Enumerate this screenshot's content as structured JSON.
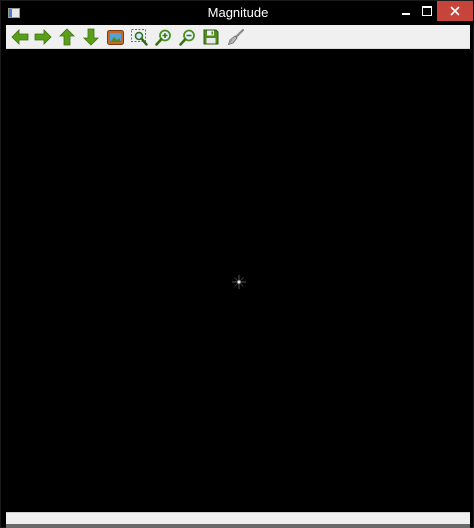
{
  "window": {
    "title": "Magnitude"
  },
  "titlebar_controls": [
    "minimize-icon",
    "maximize-icon",
    "close-icon"
  ],
  "toolbar": {
    "buttons": [
      {
        "name": "pan-left",
        "icon": "arrow-left-icon"
      },
      {
        "name": "pan-right",
        "icon": "arrow-right-icon"
      },
      {
        "name": "pan-up",
        "icon": "arrow-up-icon"
      },
      {
        "name": "pan-down",
        "icon": "arrow-down-icon"
      },
      {
        "name": "fit-image",
        "icon": "picture-icon"
      },
      {
        "name": "zoom-region",
        "icon": "zoom-region-icon"
      },
      {
        "name": "zoom-in",
        "icon": "zoom-in-icon"
      },
      {
        "name": "zoom-out",
        "icon": "zoom-out-icon"
      },
      {
        "name": "save",
        "icon": "save-icon"
      },
      {
        "name": "copy",
        "icon": "brush-icon"
      }
    ]
  },
  "status": {
    "text": ""
  },
  "colors": {
    "icon_green": "#5a9e1a",
    "close_red": "#c7443c",
    "toolbar_bg": "#f0f0f0",
    "canvas_bg": "#000000"
  }
}
